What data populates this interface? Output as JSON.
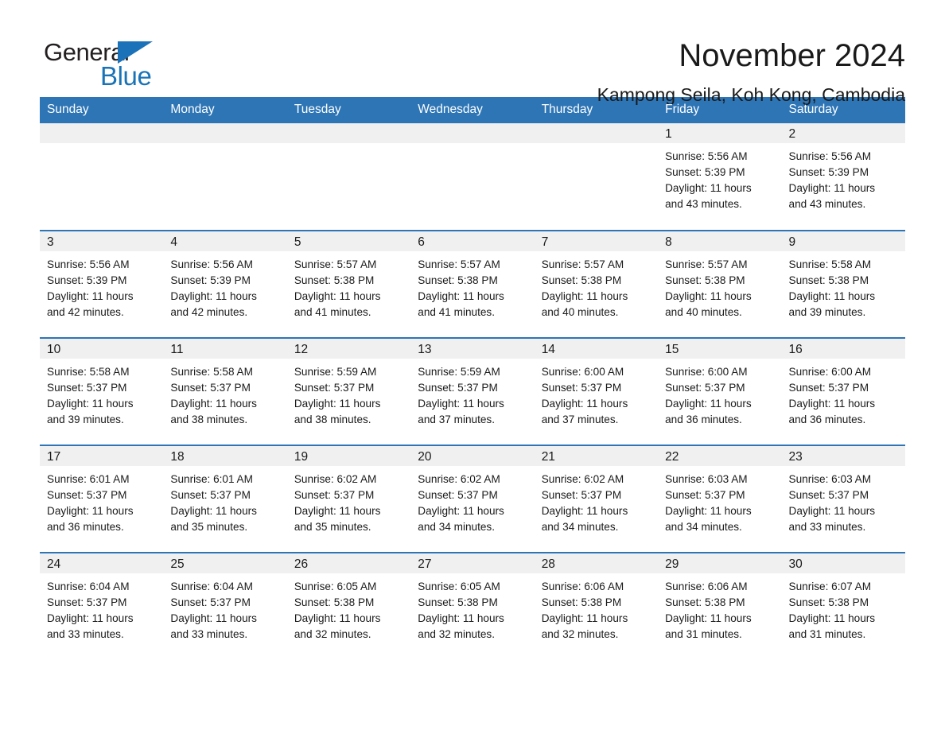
{
  "brand": {
    "name_part1": "General",
    "name_part2": "Blue",
    "accent_color": "#1a73b7"
  },
  "header": {
    "title": "November 2024",
    "subtitle": "Kampong Seila, Koh Kong, Cambodia"
  },
  "theme": {
    "header_blue": "#2e75b6",
    "daynum_gray": "#f0f0f0",
    "text": "#1a1a1a"
  },
  "calendar": {
    "weekday_headers": [
      "Sunday",
      "Monday",
      "Tuesday",
      "Wednesday",
      "Thursday",
      "Friday",
      "Saturday"
    ],
    "weeks": [
      [
        {
          "day": "",
          "sunrise": "",
          "sunset": "",
          "daylight_line1": "",
          "daylight_line2": ""
        },
        {
          "day": "",
          "sunrise": "",
          "sunset": "",
          "daylight_line1": "",
          "daylight_line2": ""
        },
        {
          "day": "",
          "sunrise": "",
          "sunset": "",
          "daylight_line1": "",
          "daylight_line2": ""
        },
        {
          "day": "",
          "sunrise": "",
          "sunset": "",
          "daylight_line1": "",
          "daylight_line2": ""
        },
        {
          "day": "",
          "sunrise": "",
          "sunset": "",
          "daylight_line1": "",
          "daylight_line2": ""
        },
        {
          "day": "1",
          "sunrise": "Sunrise: 5:56 AM",
          "sunset": "Sunset: 5:39 PM",
          "daylight_line1": "Daylight: 11 hours",
          "daylight_line2": "and 43 minutes."
        },
        {
          "day": "2",
          "sunrise": "Sunrise: 5:56 AM",
          "sunset": "Sunset: 5:39 PM",
          "daylight_line1": "Daylight: 11 hours",
          "daylight_line2": "and 43 minutes."
        }
      ],
      [
        {
          "day": "3",
          "sunrise": "Sunrise: 5:56 AM",
          "sunset": "Sunset: 5:39 PM",
          "daylight_line1": "Daylight: 11 hours",
          "daylight_line2": "and 42 minutes."
        },
        {
          "day": "4",
          "sunrise": "Sunrise: 5:56 AM",
          "sunset": "Sunset: 5:39 PM",
          "daylight_line1": "Daylight: 11 hours",
          "daylight_line2": "and 42 minutes."
        },
        {
          "day": "5",
          "sunrise": "Sunrise: 5:57 AM",
          "sunset": "Sunset: 5:38 PM",
          "daylight_line1": "Daylight: 11 hours",
          "daylight_line2": "and 41 minutes."
        },
        {
          "day": "6",
          "sunrise": "Sunrise: 5:57 AM",
          "sunset": "Sunset: 5:38 PM",
          "daylight_line1": "Daylight: 11 hours",
          "daylight_line2": "and 41 minutes."
        },
        {
          "day": "7",
          "sunrise": "Sunrise: 5:57 AM",
          "sunset": "Sunset: 5:38 PM",
          "daylight_line1": "Daylight: 11 hours",
          "daylight_line2": "and 40 minutes."
        },
        {
          "day": "8",
          "sunrise": "Sunrise: 5:57 AM",
          "sunset": "Sunset: 5:38 PM",
          "daylight_line1": "Daylight: 11 hours",
          "daylight_line2": "and 40 minutes."
        },
        {
          "day": "9",
          "sunrise": "Sunrise: 5:58 AM",
          "sunset": "Sunset: 5:38 PM",
          "daylight_line1": "Daylight: 11 hours",
          "daylight_line2": "and 39 minutes."
        }
      ],
      [
        {
          "day": "10",
          "sunrise": "Sunrise: 5:58 AM",
          "sunset": "Sunset: 5:37 PM",
          "daylight_line1": "Daylight: 11 hours",
          "daylight_line2": "and 39 minutes."
        },
        {
          "day": "11",
          "sunrise": "Sunrise: 5:58 AM",
          "sunset": "Sunset: 5:37 PM",
          "daylight_line1": "Daylight: 11 hours",
          "daylight_line2": "and 38 minutes."
        },
        {
          "day": "12",
          "sunrise": "Sunrise: 5:59 AM",
          "sunset": "Sunset: 5:37 PM",
          "daylight_line1": "Daylight: 11 hours",
          "daylight_line2": "and 38 minutes."
        },
        {
          "day": "13",
          "sunrise": "Sunrise: 5:59 AM",
          "sunset": "Sunset: 5:37 PM",
          "daylight_line1": "Daylight: 11 hours",
          "daylight_line2": "and 37 minutes."
        },
        {
          "day": "14",
          "sunrise": "Sunrise: 6:00 AM",
          "sunset": "Sunset: 5:37 PM",
          "daylight_line1": "Daylight: 11 hours",
          "daylight_line2": "and 37 minutes."
        },
        {
          "day": "15",
          "sunrise": "Sunrise: 6:00 AM",
          "sunset": "Sunset: 5:37 PM",
          "daylight_line1": "Daylight: 11 hours",
          "daylight_line2": "and 36 minutes."
        },
        {
          "day": "16",
          "sunrise": "Sunrise: 6:00 AM",
          "sunset": "Sunset: 5:37 PM",
          "daylight_line1": "Daylight: 11 hours",
          "daylight_line2": "and 36 minutes."
        }
      ],
      [
        {
          "day": "17",
          "sunrise": "Sunrise: 6:01 AM",
          "sunset": "Sunset: 5:37 PM",
          "daylight_line1": "Daylight: 11 hours",
          "daylight_line2": "and 36 minutes."
        },
        {
          "day": "18",
          "sunrise": "Sunrise: 6:01 AM",
          "sunset": "Sunset: 5:37 PM",
          "daylight_line1": "Daylight: 11 hours",
          "daylight_line2": "and 35 minutes."
        },
        {
          "day": "19",
          "sunrise": "Sunrise: 6:02 AM",
          "sunset": "Sunset: 5:37 PM",
          "daylight_line1": "Daylight: 11 hours",
          "daylight_line2": "and 35 minutes."
        },
        {
          "day": "20",
          "sunrise": "Sunrise: 6:02 AM",
          "sunset": "Sunset: 5:37 PM",
          "daylight_line1": "Daylight: 11 hours",
          "daylight_line2": "and 34 minutes."
        },
        {
          "day": "21",
          "sunrise": "Sunrise: 6:02 AM",
          "sunset": "Sunset: 5:37 PM",
          "daylight_line1": "Daylight: 11 hours",
          "daylight_line2": "and 34 minutes."
        },
        {
          "day": "22",
          "sunrise": "Sunrise: 6:03 AM",
          "sunset": "Sunset: 5:37 PM",
          "daylight_line1": "Daylight: 11 hours",
          "daylight_line2": "and 34 minutes."
        },
        {
          "day": "23",
          "sunrise": "Sunrise: 6:03 AM",
          "sunset": "Sunset: 5:37 PM",
          "daylight_line1": "Daylight: 11 hours",
          "daylight_line2": "and 33 minutes."
        }
      ],
      [
        {
          "day": "24",
          "sunrise": "Sunrise: 6:04 AM",
          "sunset": "Sunset: 5:37 PM",
          "daylight_line1": "Daylight: 11 hours",
          "daylight_line2": "and 33 minutes."
        },
        {
          "day": "25",
          "sunrise": "Sunrise: 6:04 AM",
          "sunset": "Sunset: 5:37 PM",
          "daylight_line1": "Daylight: 11 hours",
          "daylight_line2": "and 33 minutes."
        },
        {
          "day": "26",
          "sunrise": "Sunrise: 6:05 AM",
          "sunset": "Sunset: 5:38 PM",
          "daylight_line1": "Daylight: 11 hours",
          "daylight_line2": "and 32 minutes."
        },
        {
          "day": "27",
          "sunrise": "Sunrise: 6:05 AM",
          "sunset": "Sunset: 5:38 PM",
          "daylight_line1": "Daylight: 11 hours",
          "daylight_line2": "and 32 minutes."
        },
        {
          "day": "28",
          "sunrise": "Sunrise: 6:06 AM",
          "sunset": "Sunset: 5:38 PM",
          "daylight_line1": "Daylight: 11 hours",
          "daylight_line2": "and 32 minutes."
        },
        {
          "day": "29",
          "sunrise": "Sunrise: 6:06 AM",
          "sunset": "Sunset: 5:38 PM",
          "daylight_line1": "Daylight: 11 hours",
          "daylight_line2": "and 31 minutes."
        },
        {
          "day": "30",
          "sunrise": "Sunrise: 6:07 AM",
          "sunset": "Sunset: 5:38 PM",
          "daylight_line1": "Daylight: 11 hours",
          "daylight_line2": "and 31 minutes."
        }
      ]
    ]
  }
}
